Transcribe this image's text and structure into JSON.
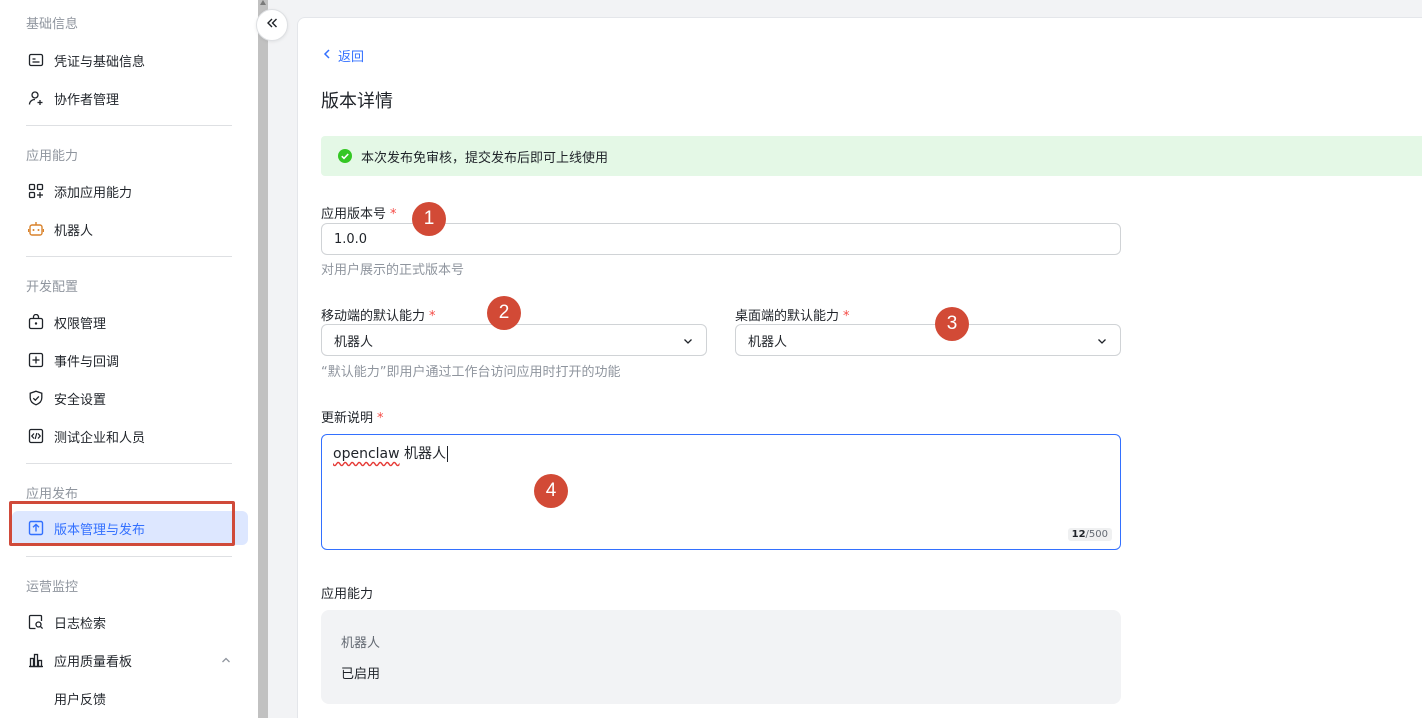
{
  "sidebar": {
    "groups": {
      "basic": "基础信息",
      "ability": "应用能力",
      "dev": "开发配置",
      "publish": "应用发布",
      "ops": "运营监控"
    },
    "items": {
      "credentials": "凭证与基础信息",
      "collaborators": "协作者管理",
      "add_ability": "添加应用能力",
      "bot": "机器人",
      "permissions": "权限管理",
      "events": "事件与回调",
      "security": "安全设置",
      "test_org": "测试企业和人员",
      "version": "版本管理与发布",
      "logs": "日志检索",
      "quality": "应用质量看板",
      "feedback": "用户反馈"
    }
  },
  "main": {
    "back_label": "返回",
    "title": "版本详情",
    "notice": "本次发布免审核，提交发布后即可上线使用",
    "version": {
      "label": "应用版本号",
      "required": "*",
      "value": "1.0.0",
      "hint": "对用户展示的正式版本号"
    },
    "mobile_default": {
      "label": "移动端的默认能力",
      "required": "*",
      "value": "机器人"
    },
    "desktop_default": {
      "label": "桌面端的默认能力",
      "required": "*",
      "value": "机器人"
    },
    "default_hint": "“默认能力”即用户通过工作台访问应用时打开的功能",
    "update_notes": {
      "label": "更新说明",
      "required": "*",
      "value_word1": "openclaw",
      "value_word2": " 机器人",
      "count": "12",
      "max": "/500"
    },
    "capabilities": {
      "label": "应用能力",
      "name": "机器人",
      "status": "已启用"
    }
  },
  "annotations": [
    "1",
    "2",
    "3",
    "4"
  ],
  "colors": {
    "accent": "#3370ff",
    "annotation": "#d24a36",
    "success_bg": "#e4f8e6",
    "success_icon": "#34c724",
    "required": "#f54a45",
    "bot_icon": "#d9822b"
  }
}
